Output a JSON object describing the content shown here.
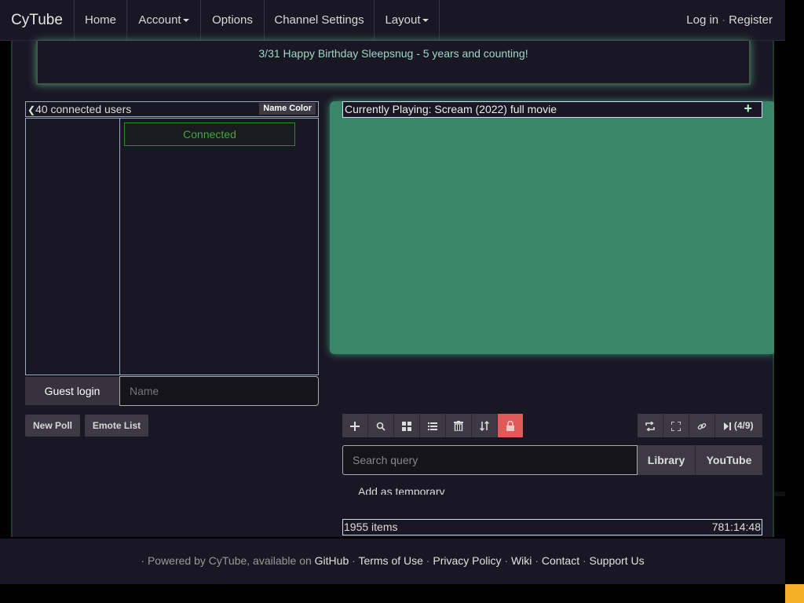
{
  "navbar": {
    "brand": "CyTube",
    "items": [
      "Home",
      "Account",
      "Options",
      "Channel Settings",
      "Layout"
    ],
    "login": "Log in",
    "separator": "·",
    "register": "Register"
  },
  "motd": {
    "text": "3/31 Happy Birthday Sleepsnug - 5 years and counting!"
  },
  "chat": {
    "usercount": "40 connected users",
    "name_color_label": "Name Color",
    "connected_message": "Connected",
    "guest_login_label": "Guest login",
    "name_placeholder": "Name"
  },
  "poll_buttons": {
    "new_poll": "New Poll",
    "emote_list": "Emote List"
  },
  "player": {
    "current_title": "Currently Playing: Scream (2022) full movie",
    "video_color": "#39866a"
  },
  "playlist": {
    "tools_left": [
      "plus-icon",
      "search-icon",
      "grid-icon",
      "list-icon",
      "trash-icon",
      "sort-icon",
      "lock-icon"
    ],
    "tools_right_label": "(4/9)",
    "search_placeholder": "Search query",
    "library_label": "Library",
    "youtube_label": "YouTube",
    "add_temp_label": "Add as temporary",
    "item_count": "1955 items",
    "total_time": "781:14:48"
  },
  "footer": {
    "prefix": "· Powered by CyTube, available on ",
    "links": [
      "GitHub",
      "Terms of Use",
      "Privacy Policy",
      "Wiki",
      "Contact",
      "Support Us"
    ],
    "separator": "·"
  },
  "colors": {
    "accent": "#39866a",
    "lock_active": "#e05a5a",
    "corner": "#f5b027"
  }
}
